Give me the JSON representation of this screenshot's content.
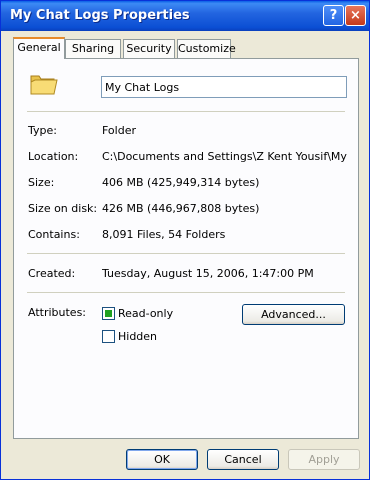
{
  "window": {
    "title": "My Chat Logs Properties"
  },
  "titlebar": {
    "help_glyph": "?",
    "close_glyph": "×"
  },
  "tabs": [
    {
      "label": "General",
      "active": true
    },
    {
      "label": "Sharing",
      "active": false
    },
    {
      "label": "Security",
      "active": false
    },
    {
      "label": "Customize",
      "active": false
    }
  ],
  "general": {
    "name_value": "My Chat Logs",
    "icon": "folder-icon",
    "rows": [
      {
        "label": "Type:",
        "value": "Folder"
      },
      {
        "label": "Location:",
        "value": "C:\\Documents and Settings\\Z Kent Yousif\\My Doc"
      },
      {
        "label": "Size:",
        "value": "406 MB (425,949,314 bytes)"
      },
      {
        "label": "Size on disk:",
        "value": "426 MB (446,967,808 bytes)"
      },
      {
        "label": "Contains:",
        "value": "8,091 Files, 54 Folders"
      }
    ],
    "created": {
      "label": "Created:",
      "value": "Tuesday, August 15, 2006, 1:47:00 PM"
    },
    "attributes": {
      "label": "Attributes:",
      "readonly": {
        "label": "Read-only",
        "checked": true
      },
      "hidden": {
        "label": "Hidden",
        "checked": false
      },
      "advanced_label": "Advanced..."
    }
  },
  "buttons": {
    "ok": "OK",
    "cancel": "Cancel",
    "apply": "Apply"
  },
  "colors": {
    "titlebar": "#0a4fd4",
    "active_tab_accent": "#e68b2c",
    "dialog_bg": "#ece9d8"
  }
}
